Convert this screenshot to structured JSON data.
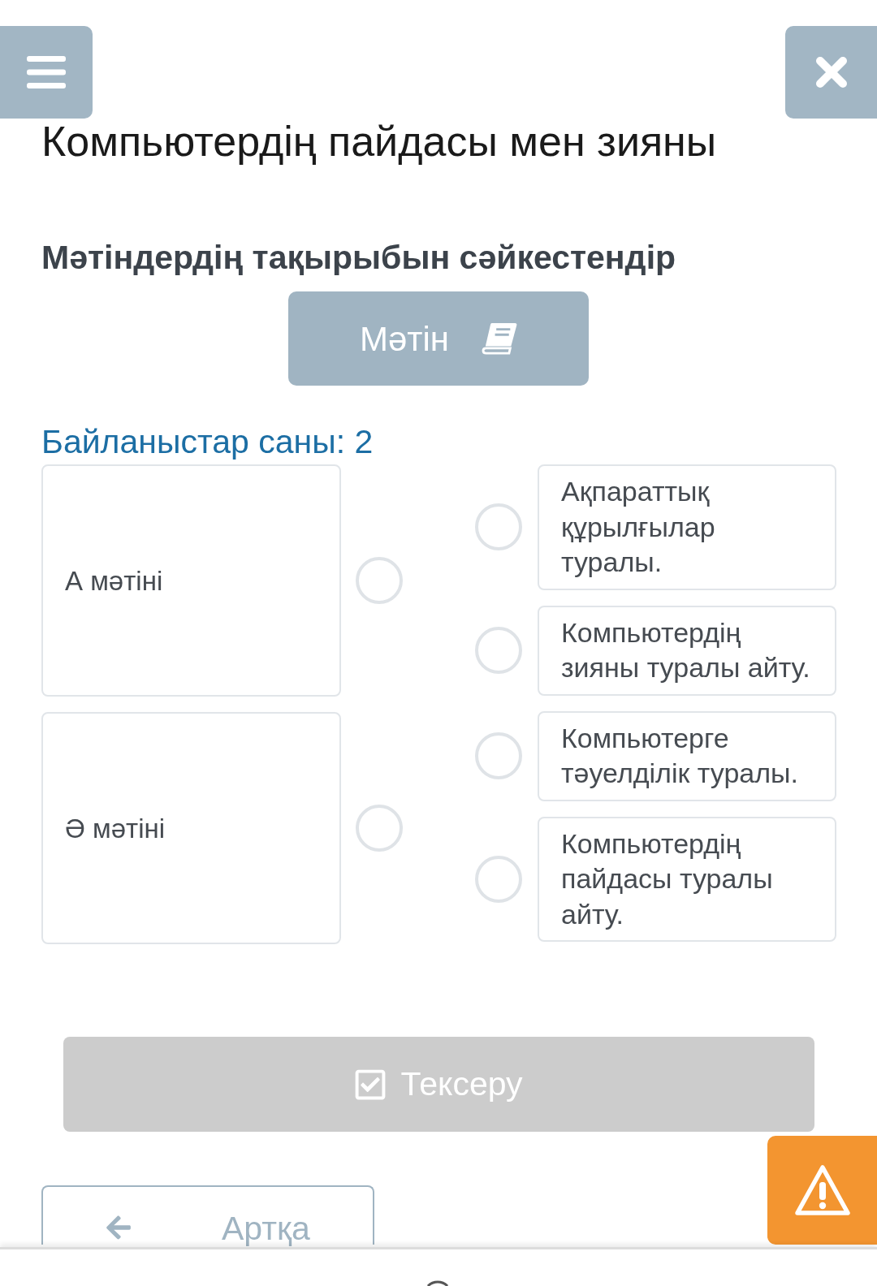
{
  "title": "Компьютердің пайдасы мен зияны",
  "task": "Мәтіндердің тақырыбын сәйкестендір",
  "text_button": {
    "label": "Мәтін"
  },
  "connections": "Байланыстар саны: 2",
  "left_items": [
    {
      "label": "А мәтіні"
    },
    {
      "label": "Ә мәтіні"
    }
  ],
  "right_items": [
    {
      "label": "Ақпараттық құрылғылар туралы."
    },
    {
      "label": "Компьютердің зияны туралы айту."
    },
    {
      "label": "Компьютерге тәуелділік туралы."
    },
    {
      "label": "Компьютердің пайдасы туралы айту."
    }
  ],
  "check_button": {
    "label": "Тексеру",
    "disabled": true
  },
  "back_button": {
    "label": "Артқа"
  }
}
